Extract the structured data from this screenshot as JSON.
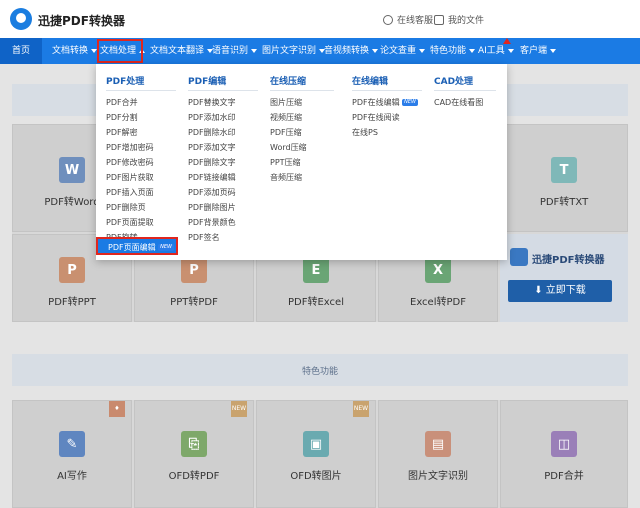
{
  "header": {
    "brand": "迅捷PDF转换器",
    "service_link": "在线客服",
    "files_link": "我的文件"
  },
  "nav": {
    "items": [
      {
        "label": "首页"
      },
      {
        "label": "文档转换"
      },
      {
        "label": "文档处理"
      },
      {
        "label": "文档文本翻译"
      },
      {
        "label": "语音识别"
      },
      {
        "label": "图片文字识别"
      },
      {
        "label": "音视频转换"
      },
      {
        "label": "论文查重"
      },
      {
        "label": "特色功能"
      },
      {
        "label": "AI工具"
      },
      {
        "label": "客户端"
      }
    ],
    "badge_new": "新"
  },
  "dropdown": {
    "columns": [
      {
        "title": "PDF处理",
        "items": [
          "PDF合并",
          "PDF分割",
          "PDF解密",
          "PDF增加密码",
          "PDF修改密码",
          "PDF图片获取",
          "PDF插入页面",
          "PDF删除页",
          "PDF页面提取",
          "PDF旋转"
        ]
      },
      {
        "title": "PDF编辑",
        "items": [
          "PDF替换文字",
          "PDF添加水印",
          "PDF删除水印",
          "PDF添加文字",
          "PDF删除文字",
          "PDF链接编辑",
          "PDF添加页码",
          "PDF删除图片",
          "PDF背景颜色",
          "PDF签名"
        ]
      },
      {
        "title": "在线压缩",
        "items": [
          "图片压缩",
          "视频压缩",
          "PDF压缩",
          "Word压缩",
          "PPT压缩",
          "音频压缩"
        ]
      },
      {
        "title": "在线编辑",
        "items": [
          "PDF在线编辑",
          "PDF在线阅读",
          "在线PS"
        ]
      },
      {
        "title": "CAD处理",
        "items": [
          "CAD在线看图"
        ]
      }
    ],
    "highlighted_item": "PDF页面编辑",
    "new_tag": "NEW"
  },
  "cards_row1": [
    {
      "label": "PDF转Word",
      "icon": "W"
    },
    {
      "label": "PDF转TXT",
      "icon": "T"
    }
  ],
  "cards_row2": [
    {
      "label": "PDF转PPT",
      "icon": "P"
    },
    {
      "label": "PPT转PDF",
      "icon": "P"
    },
    {
      "label": "PDF转Excel",
      "icon": "E"
    },
    {
      "label": "Excel转PDF",
      "icon": "X"
    }
  ],
  "download": {
    "brand": "迅捷PDF转换器",
    "button": "立即下载"
  },
  "features": {
    "title": "特色功能",
    "new_corner": "NEW",
    "cards": [
      {
        "label": "AI写作"
      },
      {
        "label": "OFD转PDF"
      },
      {
        "label": "OFD转图片"
      },
      {
        "label": "图片文字识别"
      },
      {
        "label": "PDF合并"
      }
    ]
  },
  "colors": {
    "nav_blue": "#1b7be4",
    "highlight_red": "#e0261e",
    "accent_orange": "#ff6a00"
  }
}
